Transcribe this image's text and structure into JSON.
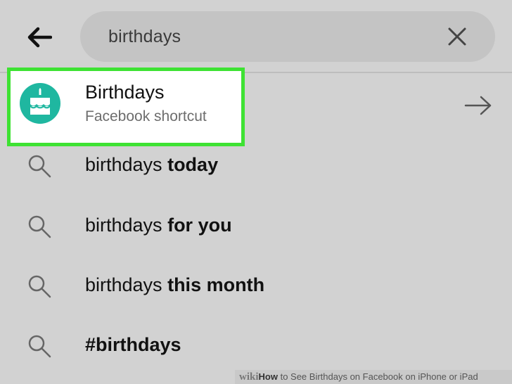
{
  "search": {
    "query": "birthdays"
  },
  "shortcut": {
    "title": "Birthdays",
    "subtitle": "Facebook shortcut"
  },
  "suggestions": [
    {
      "prefix": "birthdays",
      "bold": "today"
    },
    {
      "prefix": "birthdays",
      "bold": "for you"
    },
    {
      "prefix": "birthdays",
      "bold": "this month"
    },
    {
      "prefix": "",
      "bold": "#birthdays"
    }
  ],
  "watermark": {
    "wiki": "wiki",
    "how": "How",
    "rest": " to See Birthdays on Facebook on iPhone or iPad"
  },
  "colors": {
    "highlight": "#3ee233",
    "avatar": "#1fb7a0"
  },
  "icons": [
    "back-arrow-icon",
    "clear-icon",
    "cake-icon",
    "forward-arrow-icon",
    "search-icon"
  ]
}
